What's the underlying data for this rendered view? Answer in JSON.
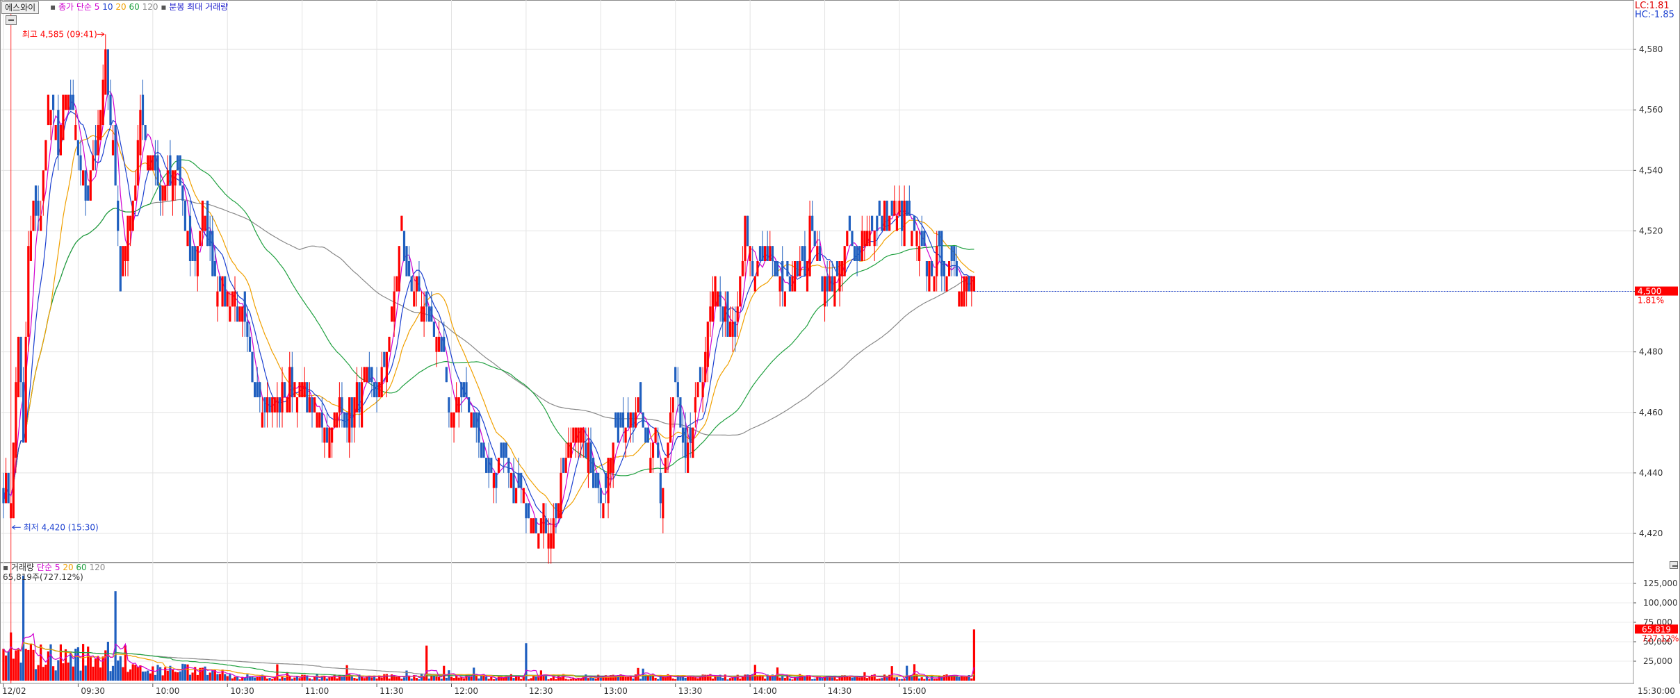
{
  "header": {
    "instrument_button": "에스와이",
    "ma_label": "종가 단순",
    "ma_periods": [
      "5",
      "10",
      "20",
      "60",
      "120"
    ],
    "chart_mode": "분봉 최대 거래량"
  },
  "right_info": {
    "lc": "LC:1.81",
    "hc": "HC:-1.85"
  },
  "volume_header": {
    "title": "거래량",
    "ma_label": "단순",
    "ma_periods": [
      "5",
      "20",
      "60",
      "120"
    ],
    "current_value": "65,819주(727.12%)"
  },
  "price_axis": {
    "ticks": [
      "4,580",
      "4,560",
      "4,540",
      "4,520",
      "4,500",
      "4,480",
      "4,460",
      "4,440",
      "4,420"
    ],
    "current_price_label": "4,500",
    "current_change_label": "1.81%"
  },
  "volume_axis": {
    "ticks": [
      "125,000",
      "100,000",
      "75,000",
      "50,000",
      "25,000"
    ],
    "current_volume_label": "65,819",
    "current_pct_label": "727.12%"
  },
  "time_axis": {
    "ticks": [
      "12/02",
      "09:30",
      "10:00",
      "10:30",
      "11:00",
      "11:30",
      "12:00",
      "12:30",
      "13:00",
      "13:30",
      "14:00",
      "14:30",
      "15:00"
    ],
    "last_label": "15:30:00"
  },
  "annotations": {
    "high": "최고 4,585 (09:41)",
    "low": "최저 4,420 (15:30)"
  },
  "colors": {
    "up": "#ff0000",
    "down": "#1f5fbf",
    "ma5": "#d000d0",
    "ma10": "#1a3fd0",
    "ma20": "#f0a000",
    "ma60": "#1fa03f",
    "ma120": "#888888"
  },
  "chart_data": [
    {
      "type": "candlestick",
      "title": "",
      "interval": "1 minute",
      "ylim": [
        4410,
        4590
      ],
      "x_range": [
        "09:00",
        "15:30"
      ],
      "series": [
        {
          "name": "5",
          "indicator": "SMA"
        },
        {
          "name": "10",
          "indicator": "SMA"
        },
        {
          "name": "20",
          "indicator": "SMA"
        },
        {
          "name": "60",
          "indicator": "SMA"
        },
        {
          "name": "120",
          "indicator": "SMA"
        }
      ],
      "close_path": {
        "x": [
          "09:00",
          "09:03",
          "09:06",
          "09:08",
          "09:10",
          "09:12",
          "09:15",
          "09:18",
          "09:22",
          "09:25",
          "09:28",
          "09:30",
          "09:33",
          "09:36",
          "09:38",
          "09:41",
          "09:44",
          "09:47",
          "09:50",
          "09:53",
          "09:55",
          "09:58",
          "10:00",
          "10:03",
          "10:06",
          "10:10",
          "10:15",
          "10:18",
          "10:20",
          "10:24",
          "10:28",
          "10:32",
          "10:36",
          "10:40",
          "10:45",
          "10:50",
          "10:55",
          "11:00",
          "11:05",
          "11:10",
          "11:15",
          "11:20",
          "11:25",
          "11:30",
          "11:35",
          "11:40",
          "11:42",
          "11:45",
          "11:48",
          "11:52",
          "11:56",
          "12:00",
          "12:05",
          "12:10",
          "12:14",
          "12:18",
          "12:22",
          "12:25",
          "12:27",
          "12:30",
          "12:35",
          "12:40",
          "12:45",
          "12:50",
          "12:55",
          "13:00",
          "13:05",
          "13:10",
          "13:15",
          "13:20",
          "13:22",
          "13:24",
          "13:27",
          "13:30",
          "13:34",
          "13:38",
          "13:42",
          "13:46",
          "13:50",
          "13:54",
          "13:58",
          "14:02",
          "14:05",
          "14:08",
          "14:11",
          "14:14",
          "14:18",
          "14:21",
          "14:24",
          "14:27",
          "14:30",
          "14:33",
          "14:36",
          "14:39",
          "14:42",
          "14:46",
          "14:50",
          "14:54",
          "14:58",
          "15:02",
          "15:06",
          "15:10",
          "15:14",
          "15:18",
          "15:20"
        ],
        "values": [
          4435,
          4432,
          4485,
          4450,
          4515,
          4525,
          4525,
          4565,
          4550,
          4565,
          4555,
          4545,
          4530,
          4545,
          4550,
          4575,
          4550,
          4505,
          4525,
          4530,
          4565,
          4545,
          4545,
          4530,
          4535,
          4540,
          4510,
          4515,
          4525,
          4510,
          4500,
          4500,
          4490,
          4470,
          4465,
          4462,
          4470,
          4468,
          4460,
          4455,
          4462,
          4460,
          4470,
          4465,
          4485,
          4522,
          4505,
          4500,
          4495,
          4490,
          4480,
          4460,
          4465,
          4455,
          4440,
          4440,
          4442,
          4432,
          4432,
          4430,
          4425,
          4422,
          4440,
          4458,
          4445,
          4432,
          4448,
          4458,
          4462,
          4442,
          4455,
          4430,
          4452,
          4470,
          4440,
          4460,
          4480,
          4502,
          4490,
          4485,
          4520,
          4505,
          4515,
          4510,
          4503,
          4500,
          4510,
          4505,
          4520,
          4517,
          4500,
          4505,
          4505,
          4520,
          4510,
          4520,
          4520,
          4525,
          4525,
          4525,
          4517,
          4510,
          4510,
          4507,
          4505
        ]
      }
    },
    {
      "type": "bar",
      "title": "",
      "ylim": [
        0,
        137500
      ],
      "series": [
        {
          "name": "5",
          "indicator": "SMA"
        },
        {
          "name": "20",
          "indicator": "SMA"
        },
        {
          "name": "60",
          "indicator": "SMA"
        },
        {
          "name": "120",
          "indicator": "SMA"
        }
      ],
      "last_value": 65819,
      "spikes": [
        {
          "x": "09:08",
          "value": 135000
        },
        {
          "x": "09:03",
          "value": 62000
        },
        {
          "x": "09:45",
          "value": 115000
        },
        {
          "x": "09:42",
          "value": 50000
        },
        {
          "x": "11:50",
          "value": 45000
        },
        {
          "x": "12:30",
          "value": 48000
        },
        {
          "x": "15:30",
          "value": 65819
        }
      ]
    }
  ]
}
